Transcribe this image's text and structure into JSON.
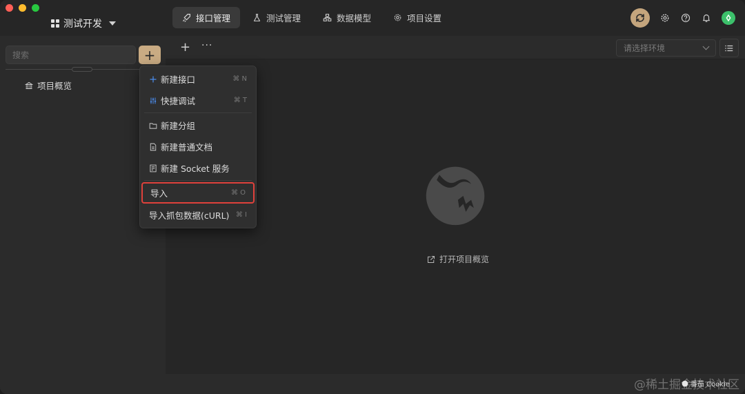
{
  "project": {
    "name": "测试开发"
  },
  "tabs": [
    {
      "label": "接口管理",
      "icon": "rocket-icon",
      "active": true
    },
    {
      "label": "测试管理",
      "icon": "flask-icon",
      "active": false
    },
    {
      "label": "数据模型",
      "icon": "model-icon",
      "active": false
    },
    {
      "label": "项目设置",
      "icon": "gear-icon",
      "active": false
    }
  ],
  "sidebar": {
    "search_placeholder": "搜索",
    "add_label": "+",
    "overview_label": "项目概览"
  },
  "toolbar": {
    "plus": "+",
    "more": "···",
    "env_placeholder": "请选择环境"
  },
  "menu": {
    "items": [
      {
        "label": "新建接口",
        "shortcut": "⌘ N"
      },
      {
        "label": "快捷调试",
        "shortcut": "⌘ T"
      },
      {
        "label": "新建分组",
        "shortcut": ""
      },
      {
        "label": "新建普通文档",
        "shortcut": ""
      },
      {
        "label": "新建 Socket 服务",
        "shortcut": ""
      },
      {
        "label": "导入",
        "shortcut": "⌘ O"
      },
      {
        "label": "导入抓包数据(cURL)",
        "shortcut": "⌘ I"
      }
    ]
  },
  "main": {
    "open_overview": "打开项目概览"
  },
  "watermark": {
    "site": "@稀土掘金技术社区",
    "author": "番茄 Cookie"
  },
  "colors": {
    "accent": "#c9ab83",
    "highlight": "#e0413b",
    "avatar": "#3cc06b"
  }
}
